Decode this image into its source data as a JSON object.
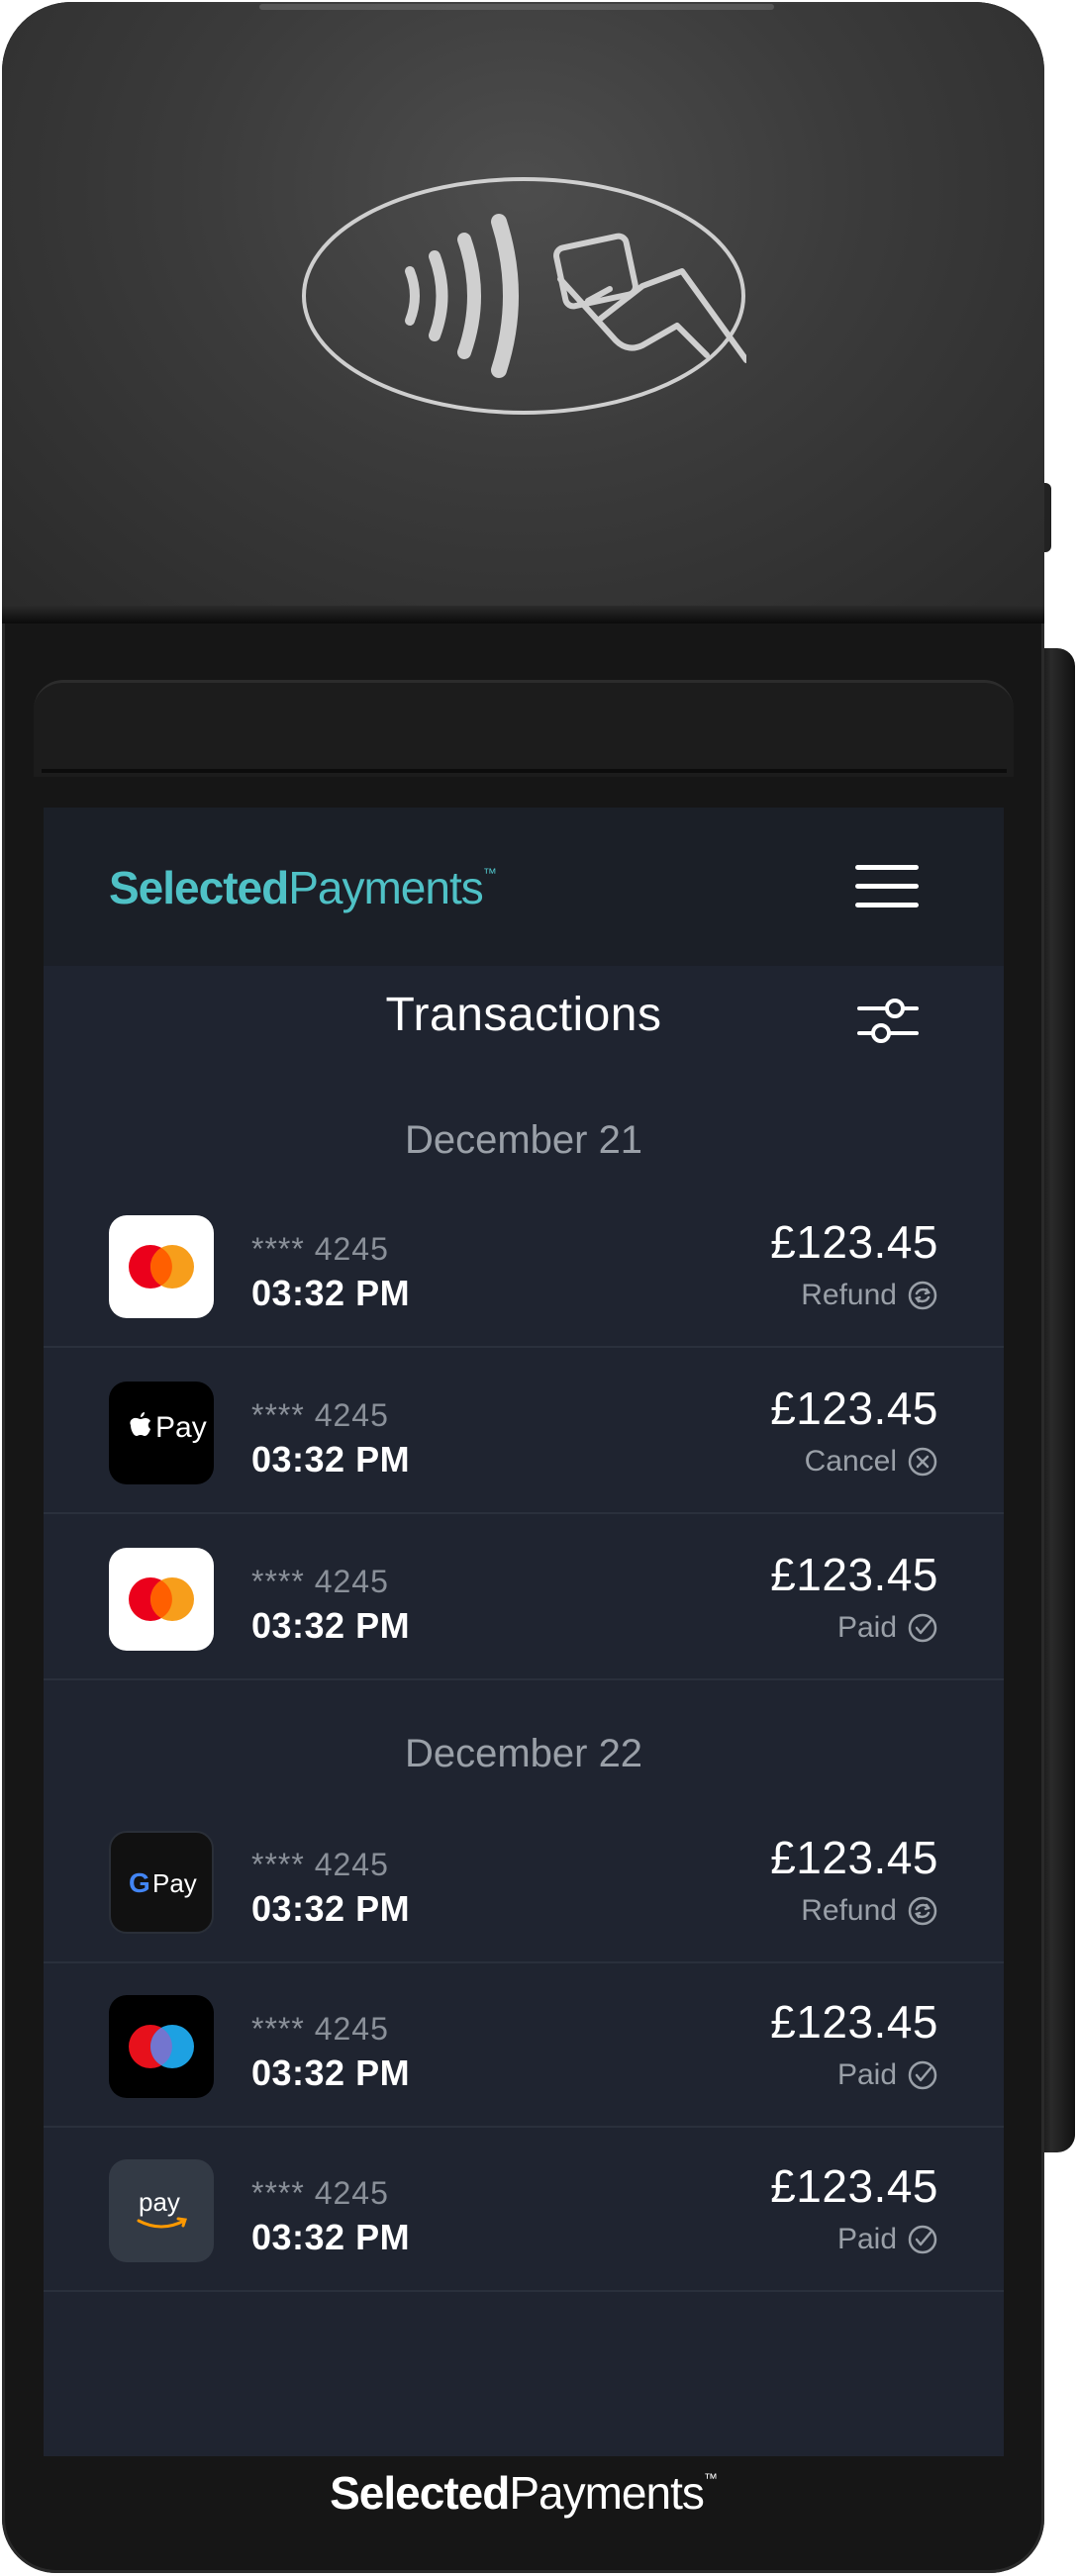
{
  "brand": {
    "name_bold": "Selected",
    "name_light": "Payments",
    "trademark": "™",
    "accent_color": "#4fc1c6"
  },
  "header": {
    "menu_icon": "hamburger-menu-icon"
  },
  "page": {
    "title": "Transactions",
    "filter_icon": "filter-sliders-icon"
  },
  "groups": [
    {
      "date": "December 21",
      "transactions": [
        {
          "method": "mastercard",
          "card": "**** 4245",
          "time": "03:32 PM",
          "amount": "£123.45",
          "status": "Refund",
          "status_icon": "refund-icon"
        },
        {
          "method": "apple-pay",
          "card": "**** 4245",
          "time": "03:32 PM",
          "amount": "£123.45",
          "status": "Cancel",
          "status_icon": "cancel-icon"
        },
        {
          "method": "mastercard",
          "card": "**** 4245",
          "time": "03:32 PM",
          "amount": "£123.45",
          "status": "Paid",
          "status_icon": "check-icon"
        }
      ]
    },
    {
      "date": "December 22",
      "transactions": [
        {
          "method": "google-pay",
          "card": "**** 4245",
          "time": "03:32 PM",
          "amount": "£123.45",
          "status": "Refund",
          "status_icon": "refund-icon"
        },
        {
          "method": "maestro",
          "card": "**** 4245",
          "time": "03:32 PM",
          "amount": "£123.45",
          "status": "Paid",
          "status_icon": "check-icon"
        },
        {
          "method": "amazon-pay",
          "card": "**** 4245",
          "time": "03:32 PM",
          "amount": "£123.45",
          "status": "Paid",
          "status_icon": "check-icon"
        }
      ]
    }
  ],
  "payment_logos": {
    "apple_pay_text": "Pay",
    "google_pay_text": "Pay",
    "amazon_pay_text": "pay"
  },
  "colors": {
    "screen_bg": "#1f2430",
    "header_bg": "#1b1f27",
    "muted_text": "#9aa0a8"
  }
}
